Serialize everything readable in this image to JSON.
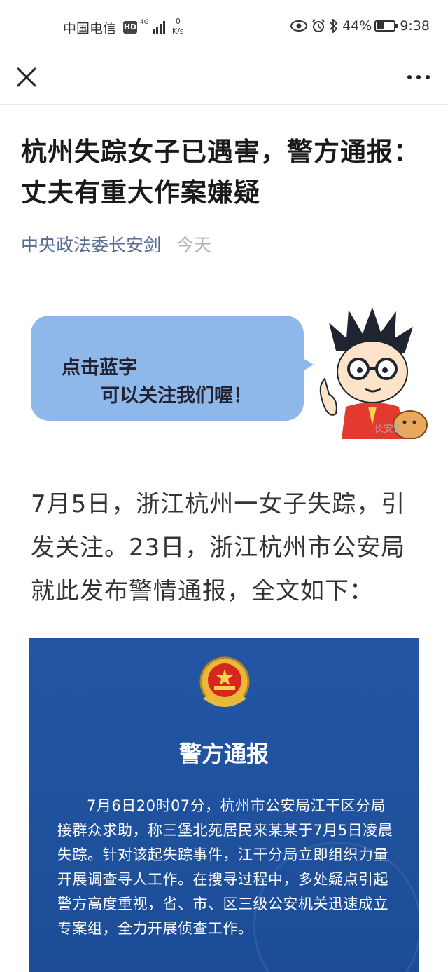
{
  "status_bar": {
    "carrier": "中国电信",
    "hd": "HD",
    "network": "4G",
    "speed_value": "0",
    "speed_unit": "K/s",
    "battery_percent": "44%",
    "battery_level": 0.44,
    "time": "9:38",
    "icons": [
      "eye-icon",
      "alarm-icon",
      "bluetooth-icon",
      "battery-icon"
    ]
  },
  "navbar": {
    "close_icon": "close-icon",
    "more_icon": "more-dots-icon"
  },
  "article": {
    "title": "杭州失踪女子已遇害，警方通报：丈夫有重大作案嫌疑",
    "account": "中央政法委长安剑",
    "date": "今天",
    "banner": {
      "line1": "点击蓝字",
      "line2": "可以关注我们喔！",
      "watermark": "长安剑"
    },
    "paragraph": "7月5日，浙江杭州一女子失踪，引发关注。23日，浙江杭州市公安局就此发布警情通报，全文如下：",
    "notice": {
      "title": "警方通报",
      "text": "7月6日20时07分，杭州市公安局江干区分局接群众求助，称三堡北苑居民来某某于7月5日凌晨失踪。针对该起失踪事件，江干分局立即组织力量开展调查寻人工作。在搜寻过程中，多处疑点引起警方高度重视，省、市、区三级公安机关迅速成立专案组，全力开展侦查工作。",
      "background_color": "#2257a6"
    }
  },
  "colors": {
    "link": "#576b95",
    "date": "#b2b2b2",
    "bubble": "#8fb8ea"
  }
}
